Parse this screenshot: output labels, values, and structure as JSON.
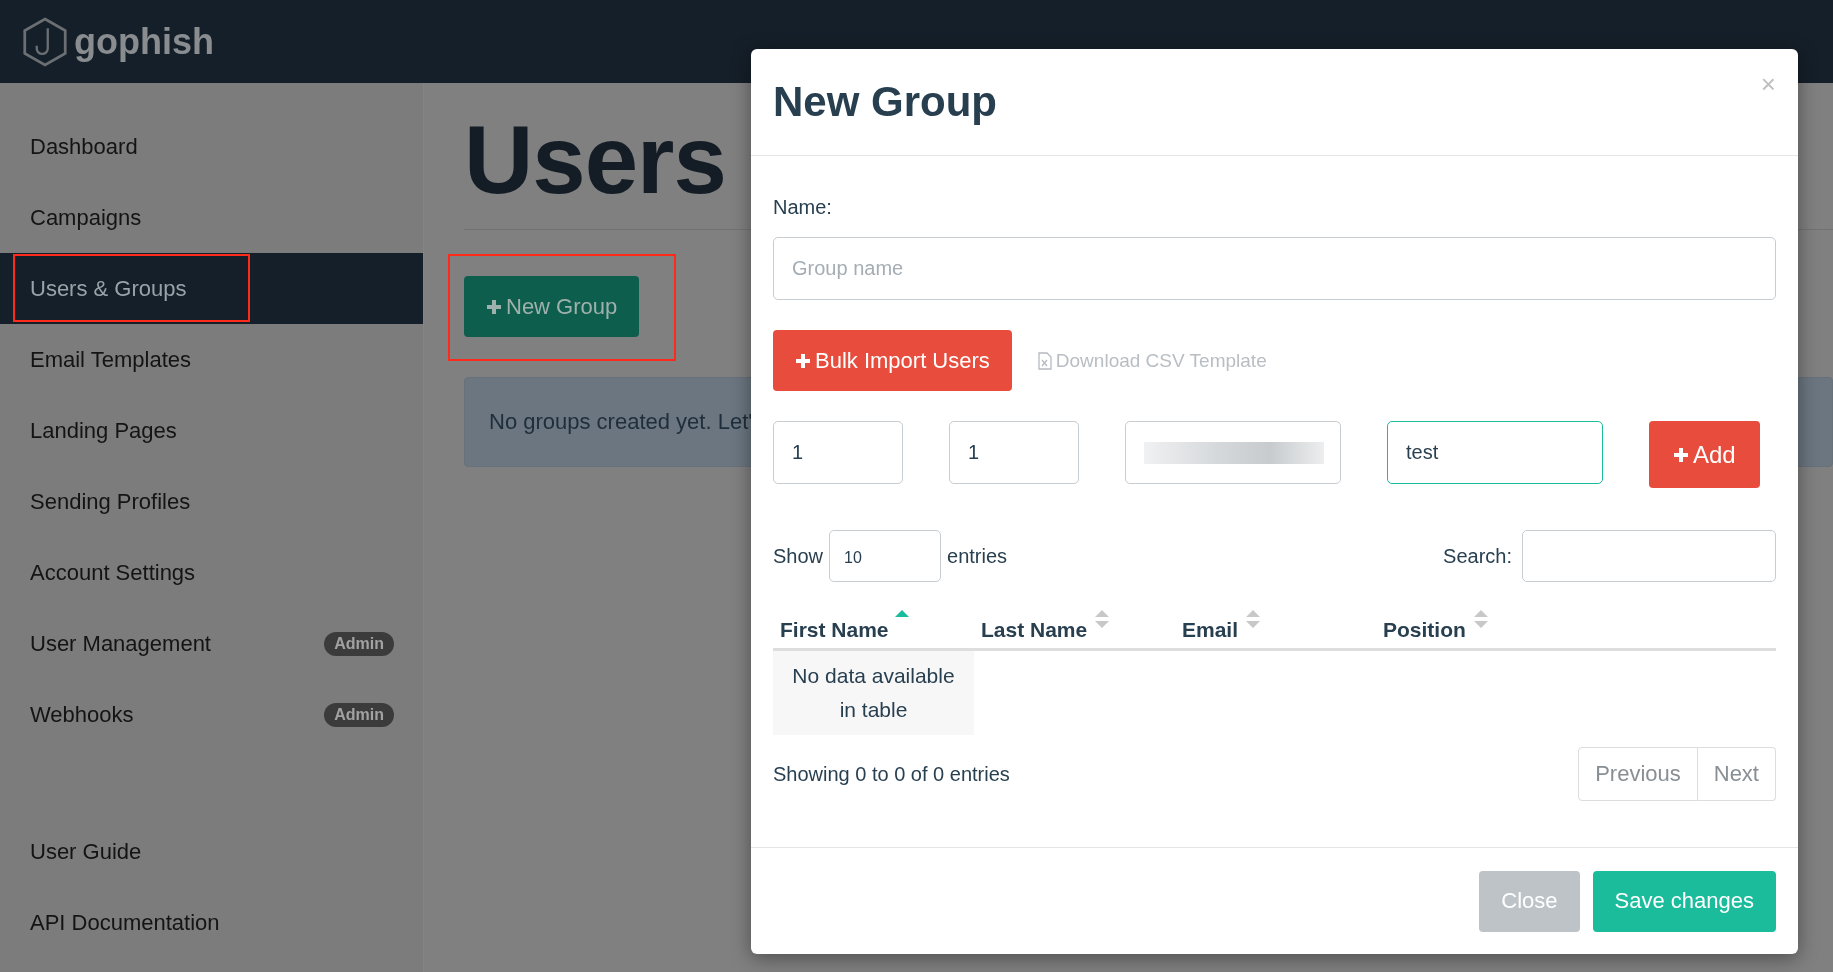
{
  "navbar": {
    "logo_text": "gophish"
  },
  "sidebar": {
    "items": [
      {
        "label": "Dashboard",
        "selected": false
      },
      {
        "label": "Campaigns",
        "selected": false
      },
      {
        "label": "Users & Groups",
        "selected": true,
        "highlighted": true
      },
      {
        "label": "Email Templates",
        "selected": false
      },
      {
        "label": "Landing Pages",
        "selected": false
      },
      {
        "label": "Sending Profiles",
        "selected": false
      },
      {
        "label": "Account Settings",
        "selected": false
      },
      {
        "label": "User Management",
        "selected": false,
        "badge": "Admin"
      },
      {
        "label": "Webhooks",
        "selected": false,
        "badge": "Admin"
      }
    ],
    "footer_items": [
      {
        "label": "User Guide",
        "selected": false
      },
      {
        "label": "API Documentation",
        "selected": false
      }
    ]
  },
  "page": {
    "title": "Users",
    "new_group_button": {
      "label": "New Group",
      "highlighted": true
    },
    "alert": "No groups created yet. Let'"
  },
  "modal": {
    "title": "New Group",
    "close": "×",
    "name_field": {
      "label": "Name:",
      "placeholder": "Group name"
    },
    "bulk_import_button": "Bulk Import Users",
    "csv_link": "Download CSV Template",
    "user_fields": [
      {
        "kind": "text",
        "value": "1",
        "focused": false
      },
      {
        "kind": "text",
        "value": "1",
        "focused": false
      },
      {
        "kind": "redacted",
        "focused": false
      },
      {
        "kind": "text",
        "value": "test",
        "focused": true
      }
    ],
    "add_button": "Add",
    "table": {
      "length_before": "Show",
      "length_value": "10",
      "length_after": "entries",
      "search_label": "Search:",
      "columns": [
        {
          "label": "First Name",
          "sorted": true
        },
        {
          "label": "Last Name",
          "sorted": false
        },
        {
          "label": "Email",
          "sorted": false
        },
        {
          "label": "Position",
          "sorted": false
        }
      ],
      "empty_message": "No data available in table",
      "info": "Showing 0 to 0 of 0 entries",
      "pagination": [
        {
          "label": "Previous",
          "disabled": true
        },
        {
          "label": "Next",
          "disabled": true
        }
      ]
    },
    "footer_buttons": [
      {
        "label": "Close",
        "kind": "secondary"
      },
      {
        "label": "Save changes",
        "kind": "primary"
      }
    ]
  }
}
